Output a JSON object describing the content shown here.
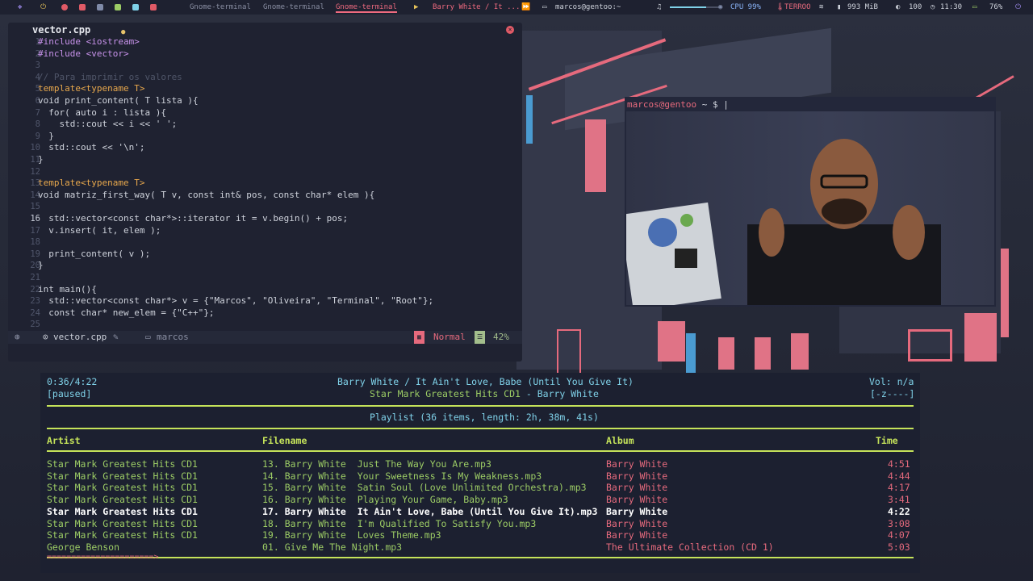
{
  "topbar": {
    "workspaces": [
      "Gnome-terminal",
      "Gnome-terminal",
      "Gnome-terminal"
    ],
    "now_playing": "Barry White / It ...",
    "window_title": "marcos@gentoo:~",
    "cpu": "CPU 99%",
    "weather": "TERROO",
    "memory": "993 MiB",
    "brightness": "100",
    "clock": "11:30",
    "battery": "76%"
  },
  "editor": {
    "tab_label": "vector.cpp",
    "close_icon": "×",
    "lines": [
      {
        "n": "1",
        "text": "#include <iostream>",
        "cls": "tp"
      },
      {
        "n": "2",
        "text": "#include <vector>",
        "cls": "tp"
      },
      {
        "n": "3",
        "text": "",
        "cls": ""
      },
      {
        "n": "4",
        "text": "// Para imprimir os valores",
        "cls": "cm"
      },
      {
        "n": "5",
        "text": "template<typename T>",
        "cls": "kw"
      },
      {
        "n": "6",
        "text": "void print_content( T lista ){",
        "cls": ""
      },
      {
        "n": "7",
        "text": "  for( auto i : lista ){",
        "cls": ""
      },
      {
        "n": "8",
        "text": "    std::cout << i << ' ';",
        "cls": ""
      },
      {
        "n": "9",
        "text": "  }",
        "cls": ""
      },
      {
        "n": "10",
        "text": "  std::cout << '\\n';",
        "cls": ""
      },
      {
        "n": "11",
        "text": "}",
        "cls": ""
      },
      {
        "n": "12",
        "text": "",
        "cls": ""
      },
      {
        "n": "13",
        "text": "template<typename T>",
        "cls": "kw"
      },
      {
        "n": "14",
        "text": "void matriz_first_way( T v, const int& pos, const char* elem ){",
        "cls": ""
      },
      {
        "n": "15",
        "text": "",
        "cls": ""
      },
      {
        "n": "16",
        "text": "  std::vector<const char*>::iterator it = v.begin() + pos;",
        "cls": ""
      },
      {
        "n": "17",
        "text": "  v.insert( it, elem );",
        "cls": ""
      },
      {
        "n": "18",
        "text": "",
        "cls": ""
      },
      {
        "n": "19",
        "text": "  print_content( v );",
        "cls": ""
      },
      {
        "n": "20",
        "text": "}",
        "cls": ""
      },
      {
        "n": "21",
        "text": "",
        "cls": ""
      },
      {
        "n": "22",
        "text": "int main(){",
        "cls": ""
      },
      {
        "n": "23",
        "text": "  std::vector<const char*> v = {\"Marcos\", \"Oliveira\", \"Terminal\", \"Root\"};",
        "cls": ""
      },
      {
        "n": "24",
        "text": "  const char* new_elem = {\"C++\"};",
        "cls": ""
      },
      {
        "n": "25",
        "text": "",
        "cls": ""
      }
    ],
    "current_line": "16",
    "status": {
      "filename": "vector.cpp",
      "folder": "marcos",
      "mode": "Normal",
      "percent": "42%"
    }
  },
  "terminal": {
    "prompt_user": "marcos@gentoo",
    "prompt_path": "~",
    "prompt_symbol": "$"
  },
  "player": {
    "position": "0:36/4:22",
    "state": "[paused]",
    "track_title": "Barry White / It Ain't Love, Babe (Until You Give It)",
    "album_line_album": "Star Mark Greatest Hits CD1",
    "album_line_sep": " - ",
    "album_line_artist": "Barry White",
    "volume": "Vol: n/a",
    "flags": "[-z----]",
    "playlist_summary": "Playlist (36 items, length: 2h, 38m, 41s)",
    "columns": {
      "artist": "Artist",
      "filename": "Filename",
      "album": "Album",
      "time": "Time"
    },
    "rows": [
      {
        "artist": "Star Mark Greatest Hits CD1",
        "filename": "13. Barry White  Just The Way You Are.mp3",
        "album": "Barry White",
        "time": "4:51",
        "current": false
      },
      {
        "artist": "Star Mark Greatest Hits CD1",
        "filename": "14. Barry White  Your Sweetness Is My Weakness.mp3",
        "album": "Barry White",
        "time": "4:44",
        "current": false
      },
      {
        "artist": "Star Mark Greatest Hits CD1",
        "filename": "15. Barry White  Satin Soul (Love Unlimited Orchestra).mp3",
        "album": "Barry White",
        "time": "4:17",
        "current": false
      },
      {
        "artist": "Star Mark Greatest Hits CD1",
        "filename": "16. Barry White  Playing Your Game, Baby.mp3",
        "album": "Barry White",
        "time": "3:41",
        "current": false
      },
      {
        "artist": "Star Mark Greatest Hits CD1",
        "filename": "17. Barry White  It Ain't Love, Babe (Until You Give It).mp3",
        "album": "Barry White",
        "time": "4:22",
        "current": true
      },
      {
        "artist": "Star Mark Greatest Hits CD1",
        "filename": "18. Barry White  I'm Qualified To Satisfy You.mp3",
        "album": "Barry White",
        "time": "3:08",
        "current": false
      },
      {
        "artist": "Star Mark Greatest Hits CD1",
        "filename": "19. Barry White  Loves Theme.mp3",
        "album": "Barry White",
        "time": "4:07",
        "current": false
      },
      {
        "artist": "George Benson",
        "filename": "01. Give Me The Night.mp3",
        "album": "The Ultimate Collection (CD 1)",
        "time": "5:03",
        "current": false
      }
    ],
    "progress_bar": "======================>"
  },
  "colors": {
    "accent_pink": "#e66a7d",
    "accent_green": "#c5e35a",
    "accent_cyan": "#7fd1e8"
  }
}
